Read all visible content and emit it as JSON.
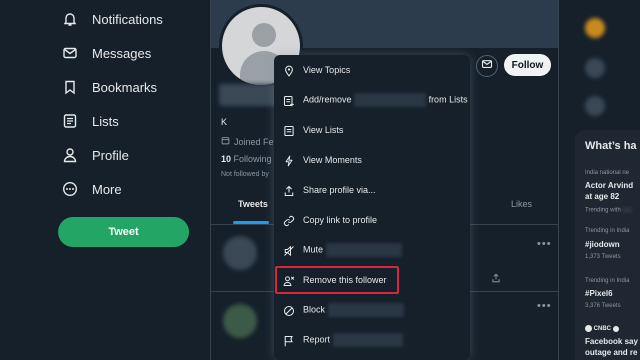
{
  "nav": {
    "items": [
      {
        "label": "Notifications",
        "icon": "bell-icon"
      },
      {
        "label": "Messages",
        "icon": "envelope-icon"
      },
      {
        "label": "Bookmarks",
        "icon": "bookmark-icon"
      },
      {
        "label": "Lists",
        "icon": "list-icon"
      },
      {
        "label": "Profile",
        "icon": "person-icon"
      },
      {
        "label": "More",
        "icon": "more-circle-icon"
      }
    ],
    "tweet_label": "Tweet"
  },
  "profile": {
    "follow_label": "Follow",
    "handle": "K",
    "joined": "Joined Feb",
    "following_count": "10",
    "following_label": "Following",
    "not_followed": "Not followed by",
    "tabs": {
      "tweets": "Tweets",
      "likes": "Likes"
    }
  },
  "menu": {
    "items": [
      {
        "label": "View Topics",
        "icon": "topics-icon"
      },
      {
        "label": "Add/remove",
        "suffix": "from Lists",
        "icon": "add-list-icon"
      },
      {
        "label": "View Lists",
        "icon": "lists-icon"
      },
      {
        "label": "View Moments",
        "icon": "lightning-icon"
      },
      {
        "label": "Share profile via...",
        "icon": "share-icon"
      },
      {
        "label": "Copy link to profile",
        "icon": "link-icon"
      },
      {
        "label": "Mute",
        "icon": "mute-icon"
      },
      {
        "label": "Remove this follower",
        "icon": "remove-follower-icon"
      },
      {
        "label": "Block",
        "icon": "block-icon"
      },
      {
        "label": "Report",
        "icon": "flag-icon"
      }
    ]
  },
  "trends": {
    "title": "What’s ha",
    "items": [
      {
        "meta": "India national ne",
        "name1": "Actor Arvind",
        "name2": "at age 82",
        "sub": "Trending with"
      },
      {
        "meta": "Trending in India",
        "name1": "#jiodown",
        "sub": "1,373 Tweets"
      },
      {
        "meta": "Trending in India",
        "name1": "#Pixel6",
        "sub": "3,376 Tweets"
      },
      {
        "meta": "CNBC",
        "name1": "Facebook say",
        "name2": "outage and re"
      }
    ]
  },
  "colors": {
    "background": "#15202b",
    "accent": "#1d9bf0",
    "tweet_button": "#22a565",
    "highlight_box": "#d7263d"
  }
}
